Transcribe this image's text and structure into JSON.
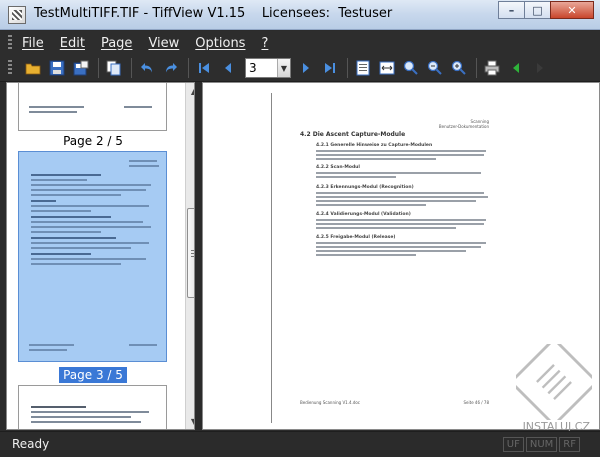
{
  "window": {
    "title": "TestMultiTIFF.TIF - TiffView V1.15    Licensees:  Testuser",
    "controls": {
      "minimize": "–",
      "maximize": "□",
      "close": "✕"
    }
  },
  "menu": {
    "items": [
      {
        "label": "File"
      },
      {
        "label": "Edit"
      },
      {
        "label": "Page"
      },
      {
        "label": "View"
      },
      {
        "label": "Options"
      },
      {
        "label": "?"
      }
    ]
  },
  "toolbar": {
    "page_number": "3",
    "icons": [
      "open-folder-icon",
      "save-icon",
      "save-as-icon",
      "copy-icon",
      "undo-icon",
      "redo-icon",
      "first-page-icon",
      "prev-page-icon",
      "next-page-icon",
      "last-page-icon",
      "fit-page-icon",
      "fit-width-icon",
      "zoom-in-icon",
      "zoom-out-icon",
      "zoom-fit-icon",
      "print-icon",
      "prev-icon",
      "next-icon"
    ]
  },
  "thumbnails": {
    "items": [
      {
        "label": "Page 2 / 5",
        "selected": false
      },
      {
        "label": "Page 3 / 5",
        "selected": true
      }
    ]
  },
  "document": {
    "header_right_1": "Scanning",
    "header_right_2": "Benutzer-Dokumentation",
    "heading": "4.2  Die Ascent Capture-Module",
    "sections": [
      "4.2.1   Generelle Hinweise zu Capture-Modulen",
      "4.2.2   Scan-Modul",
      "4.2.3   Erkennungs-Modul (Recognition)",
      "4.2.4   Validierungs-Modul (Validation)",
      "4.2.5   Freigabe-Modul (Release)"
    ],
    "footer_left": "Bedienung Scanning V1.4.doc",
    "footer_right": "Seite 46 / 78"
  },
  "status": {
    "text": "Ready",
    "panels": [
      "UF",
      "NUM",
      "RF"
    ]
  },
  "watermark": {
    "text": "INSTALUJ.CZ"
  }
}
